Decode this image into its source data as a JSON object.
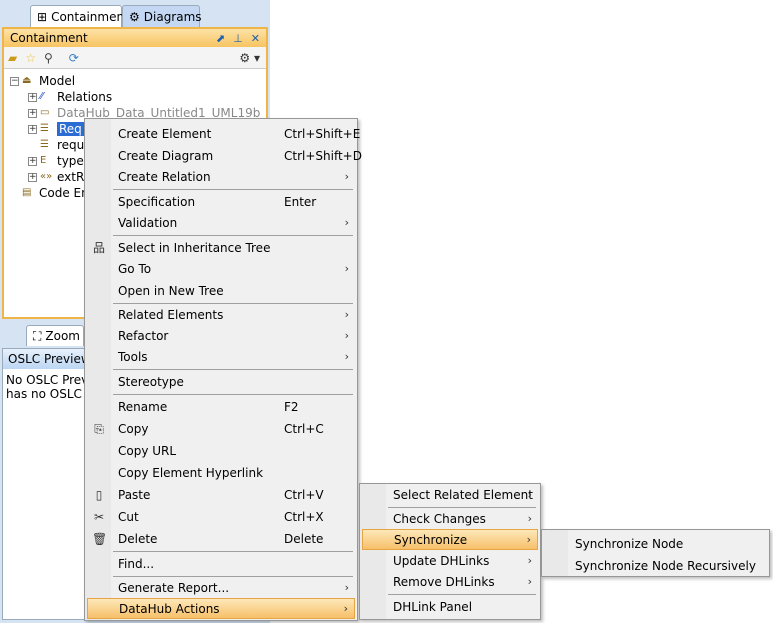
{
  "tabs": [
    {
      "label": "Containment",
      "icon": "containment-icon"
    },
    {
      "label": "Diagrams",
      "icon": "diagrams-icon"
    }
  ],
  "containment": {
    "title": "Containment",
    "tree": [
      {
        "label": "Model",
        "icon": "package-icon",
        "level": 0,
        "expander": "−"
      },
      {
        "label": "Relations",
        "icon": "relation-icon",
        "level": 1,
        "expander": "+"
      },
      {
        "label": "DataHub_Data_Untitled1_UML19b",
        "icon": "folder-icon",
        "level": 1,
        "expander": "+",
        "muted": true
      },
      {
        "label": "Req",
        "icon": "requirement-table-icon",
        "level": 1,
        "expander": "+",
        "selected": true
      },
      {
        "label": "requ",
        "icon": "requirement-icon",
        "level": 1,
        "expander": ""
      },
      {
        "label": "type",
        "icon": "enumeration-icon",
        "level": 1,
        "expander": "+"
      },
      {
        "label": "extR",
        "icon": "stereotype-icon",
        "level": 1,
        "expander": "+"
      },
      {
        "label": "Code En",
        "icon": "code-engineering-icon",
        "level": 0,
        "expander": ""
      }
    ]
  },
  "zoom_tab": {
    "label": "Zoom"
  },
  "oslc": {
    "title": "OSLC Preview",
    "lines": [
      "No OSLC Preview",
      "has no OSLC link"
    ]
  },
  "context_menu": {
    "items": [
      {
        "label": "Create Element",
        "shortcut": "Ctrl+Shift+E"
      },
      {
        "label": "Create Diagram",
        "shortcut": "Ctrl+Shift+D"
      },
      {
        "label": "Create Relation",
        "submenu": true
      },
      {
        "label": "Specification",
        "shortcut": "Enter"
      },
      {
        "label": "Validation",
        "submenu": true
      },
      {
        "label": "Select in Inheritance Tree",
        "icon": "hierarchy-icon"
      },
      {
        "label": "Go To",
        "submenu": true
      },
      {
        "label": "Open in New Tree"
      },
      {
        "label": "Related Elements",
        "submenu": true
      },
      {
        "label": "Refactor",
        "submenu": true
      },
      {
        "label": "Tools",
        "submenu": true
      },
      {
        "label": "Stereotype"
      },
      {
        "label": "Rename",
        "shortcut": "F2"
      },
      {
        "label": "Copy",
        "shortcut": "Ctrl+C",
        "icon": "copy-icon"
      },
      {
        "label": "Copy URL"
      },
      {
        "label": "Copy Element Hyperlink"
      },
      {
        "label": "Paste",
        "shortcut": "Ctrl+V",
        "icon": "paste-icon"
      },
      {
        "label": "Cut",
        "shortcut": "Ctrl+X",
        "icon": "cut-icon"
      },
      {
        "label": "Delete",
        "shortcut": "Delete",
        "icon": "trash-icon"
      },
      {
        "label": "Find..."
      },
      {
        "label": "Generate Report...",
        "submenu": true
      },
      {
        "label": "DataHub Actions",
        "submenu": true,
        "highlighted": true
      }
    ]
  },
  "datahub_menu": {
    "items": [
      {
        "label": "Select Related Element",
        "submenu": true
      },
      {
        "label": "Check Changes",
        "submenu": true
      },
      {
        "label": "Synchronize",
        "submenu": true,
        "highlighted": true
      },
      {
        "label": "Update DHLinks",
        "submenu": true
      },
      {
        "label": "Remove DHLinks",
        "submenu": true
      },
      {
        "label": "DHLink Panel"
      }
    ]
  },
  "synchronize_menu": {
    "items": [
      {
        "label": "Synchronize Node"
      },
      {
        "label": "Synchronize Node Recursively"
      }
    ]
  }
}
